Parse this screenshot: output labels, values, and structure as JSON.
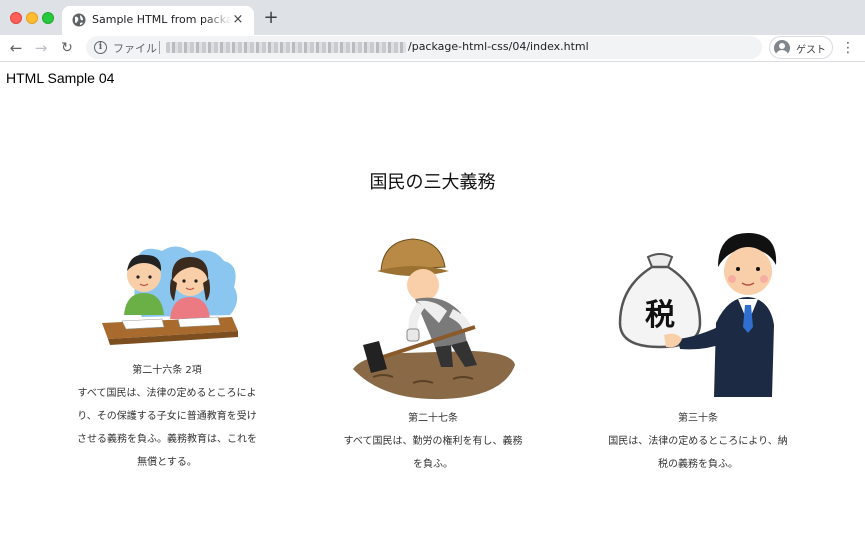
{
  "browser": {
    "tab_title": "Sample HTML from package-html-css",
    "tab_close": "×",
    "new_tab": "+",
    "back": "←",
    "forward": "→",
    "reload": "↻",
    "scheme_label": "ファイル",
    "url_path": "/package-html-css/04/index.html",
    "profile_label": "ゲスト",
    "menu": "⋮"
  },
  "page": {
    "heading": "HTML Sample 04",
    "section_title": "国民の三大義務",
    "articles": [
      {
        "title": "第二十六条 2項",
        "lines": [
          "すべて国民は、法律の定めるところによ",
          "り、その保護する子女に普通教育を受け",
          "させる義務を負ふ。義務教育は、これを",
          "無償とする。"
        ],
        "icon": "children-studying-illustration"
      },
      {
        "title": "第二十七条",
        "lines": [
          "すべて国民は、勤労の権利を有し、義務",
          "を負ふ。"
        ],
        "icon": "farmer-digging-illustration"
      },
      {
        "title": "第三十条",
        "lines": [
          "国民は、法律の定めるところにより、納",
          "税の義務を負ふ。"
        ],
        "icon": "businessman-tax-bag-illustration",
        "bag_label": "税"
      }
    ]
  }
}
